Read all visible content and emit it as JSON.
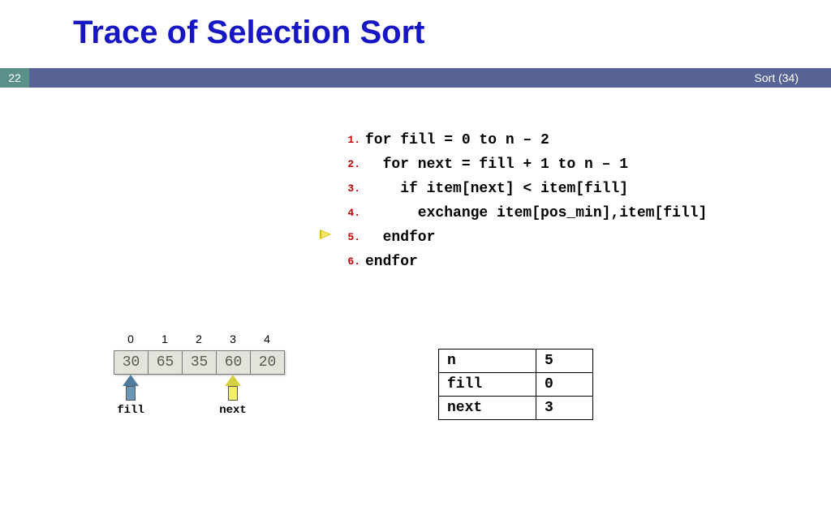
{
  "header": {
    "title": "Trace of Selection Sort",
    "page_number": "22",
    "right_text": "Sort (34)"
  },
  "code": {
    "lines": [
      {
        "n": "1.",
        "text": "for fill = 0 to n – 2"
      },
      {
        "n": "2.",
        "text": "  for next = fill + 1 to n – 1"
      },
      {
        "n": "3.",
        "text": "    if item[next] < item[fill]"
      },
      {
        "n": "4.",
        "text": "      exchange item[pos_min],item[fill]"
      },
      {
        "n": "5.",
        "text": "  endfor"
      },
      {
        "n": "6.",
        "text": "endfor"
      }
    ],
    "current_line_index": 4
  },
  "array": {
    "indices": [
      "0",
      "1",
      "2",
      "3",
      "4"
    ],
    "values": [
      "30",
      "65",
      "35",
      "60",
      "20"
    ],
    "fill_arrow_cell": 0,
    "next_arrow_cell": 3,
    "fill_label": "fill",
    "next_label": "next"
  },
  "vars": [
    {
      "name": "n",
      "value": "5"
    },
    {
      "name": "fill",
      "value": "0"
    },
    {
      "name": "next",
      "value": "3"
    }
  ]
}
